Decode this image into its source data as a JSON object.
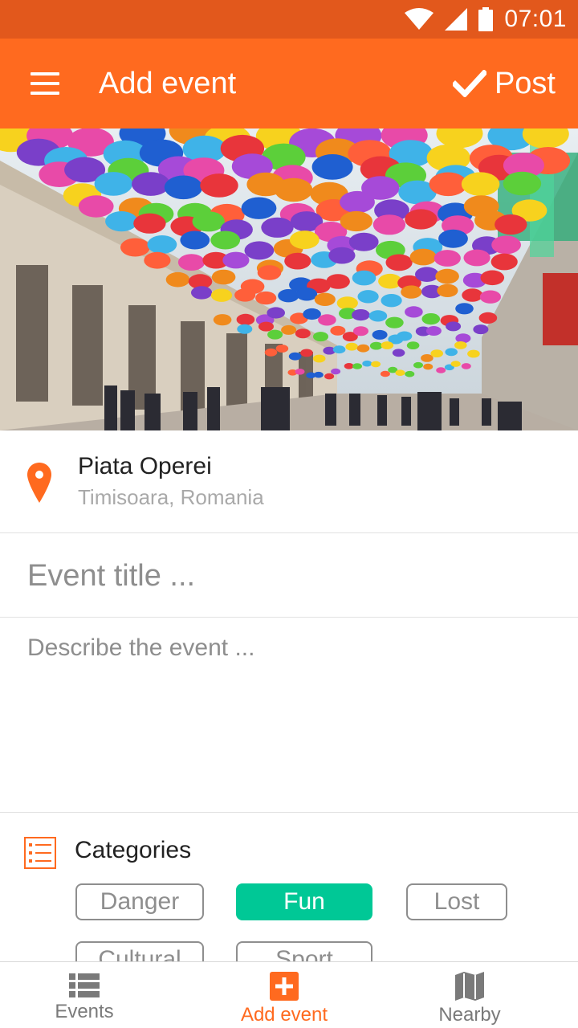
{
  "status_bar": {
    "time": "07:01"
  },
  "app_bar": {
    "title": "Add event",
    "post_label": "Post"
  },
  "location": {
    "name": "Piata Operei",
    "subtitle": "Timisoara, Romania"
  },
  "form": {
    "title_placeholder": "Event title ...",
    "description_placeholder": "Describe the event ..."
  },
  "categories": {
    "heading": "Categories",
    "chips": [
      {
        "label": "Danger",
        "selected": false
      },
      {
        "label": "Fun",
        "selected": true
      },
      {
        "label": "Lost",
        "selected": false
      },
      {
        "label": "Cultural",
        "selected": false
      },
      {
        "label": "Sport",
        "selected": false
      }
    ]
  },
  "bottom_nav": {
    "items": [
      {
        "label": "Events",
        "icon": "list-icon",
        "active": false
      },
      {
        "label": "Add event",
        "icon": "plus-box-icon",
        "active": true
      },
      {
        "label": "Nearby",
        "icon": "map-icon",
        "active": false
      }
    ]
  },
  "colors": {
    "primary": "#ff6a1f",
    "status_bar": "#e2581c",
    "accent_green": "#00c896"
  }
}
